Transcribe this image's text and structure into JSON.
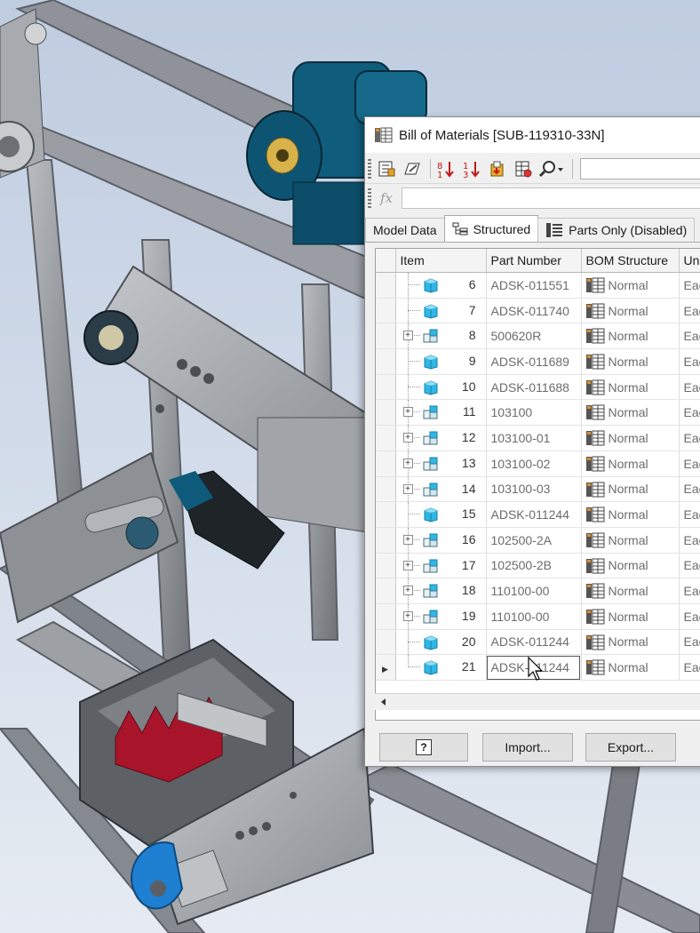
{
  "dialog": {
    "title": "Bill of Materials [SUB-119310-33N]",
    "formula_icon": "fx",
    "tabs": [
      {
        "label": "Model Data",
        "active": false
      },
      {
        "label": "Structured",
        "active": true
      },
      {
        "label": "Parts Only (Disabled)",
        "active": false
      }
    ],
    "columns": [
      "Item",
      "Part Number",
      "BOM Structure",
      "Uni"
    ],
    "rows": [
      {
        "item": "6",
        "part_number": "ADSK-011551",
        "bom_structure": "Normal",
        "unit": "Eac",
        "type": "part",
        "expandable": false
      },
      {
        "item": "7",
        "part_number": "ADSK-011740",
        "bom_structure": "Normal",
        "unit": "Eac",
        "type": "part",
        "expandable": false
      },
      {
        "item": "8",
        "part_number": "500620R",
        "bom_structure": "Normal",
        "unit": "Eac",
        "type": "assembly",
        "expandable": true
      },
      {
        "item": "9",
        "part_number": "ADSK-011689",
        "bom_structure": "Normal",
        "unit": "Eac",
        "type": "part",
        "expandable": false
      },
      {
        "item": "10",
        "part_number": "ADSK-011688",
        "bom_structure": "Normal",
        "unit": "Eac",
        "type": "part",
        "expandable": false
      },
      {
        "item": "11",
        "part_number": "103100",
        "bom_structure": "Normal",
        "unit": "Eac",
        "type": "assembly",
        "expandable": true
      },
      {
        "item": "12",
        "part_number": "103100-01",
        "bom_structure": "Normal",
        "unit": "Eac",
        "type": "assembly",
        "expandable": true
      },
      {
        "item": "13",
        "part_number": "103100-02",
        "bom_structure": "Normal",
        "unit": "Eac",
        "type": "assembly",
        "expandable": true
      },
      {
        "item": "14",
        "part_number": "103100-03",
        "bom_structure": "Normal",
        "unit": "Eac",
        "type": "assembly",
        "expandable": true
      },
      {
        "item": "15",
        "part_number": "ADSK-011244",
        "bom_structure": "Normal",
        "unit": "Eac",
        "type": "part",
        "expandable": false
      },
      {
        "item": "16",
        "part_number": "102500-2A",
        "bom_structure": "Normal",
        "unit": "Eac",
        "type": "assembly",
        "expandable": true
      },
      {
        "item": "17",
        "part_number": "102500-2B",
        "bom_structure": "Normal",
        "unit": "Eac",
        "type": "assembly",
        "expandable": true
      },
      {
        "item": "18",
        "part_number": "110100-00",
        "bom_structure": "Normal",
        "unit": "Eac",
        "type": "assembly",
        "expandable": true
      },
      {
        "item": "19",
        "part_number": "110100-00",
        "bom_structure": "Normal",
        "unit": "Eac",
        "type": "assembly",
        "expandable": true
      },
      {
        "item": "20",
        "part_number": "ADSK-011244",
        "bom_structure": "Normal",
        "unit": "Eac",
        "type": "part",
        "expandable": false
      },
      {
        "item": "21",
        "part_number": "ADSK-011244",
        "bom_structure": "Normal",
        "unit": "Eac",
        "type": "part",
        "expandable": false,
        "editing": true
      }
    ],
    "buttons": {
      "help": "?",
      "import": "Import...",
      "export": "Export..."
    }
  },
  "colors": {
    "part_icon": "#2fb7e6",
    "accent": "#0078d7",
    "motor_blue": "#0d5a7a",
    "belt_blue": "#1e7fd0"
  }
}
